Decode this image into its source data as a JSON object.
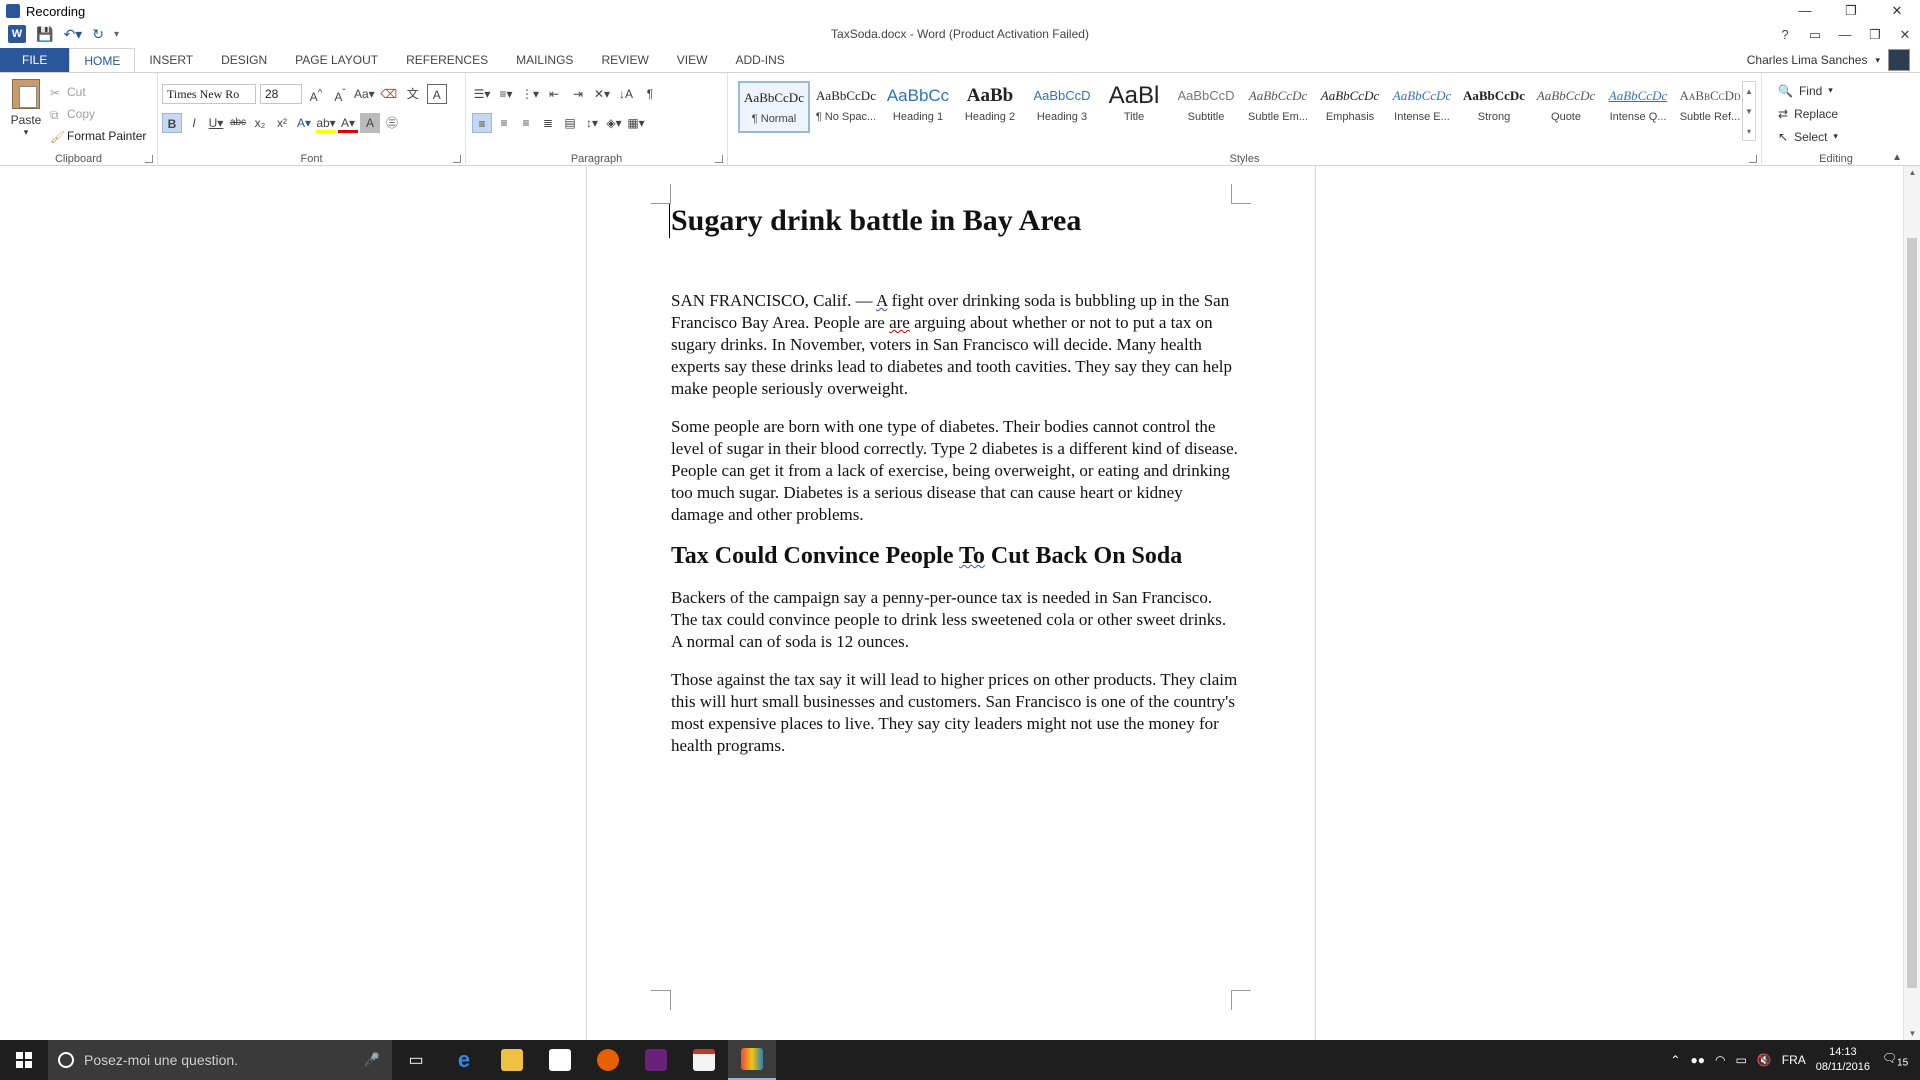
{
  "recording": {
    "title": "Recording"
  },
  "window": {
    "title": "TaxSoda.docx - Word (Product Activation Failed)"
  },
  "ribbon_tabs": [
    "FILE",
    "HOME",
    "INSERT",
    "DESIGN",
    "PAGE LAYOUT",
    "REFERENCES",
    "MAILINGS",
    "REVIEW",
    "VIEW",
    "ADD-INS"
  ],
  "user": {
    "name": "Charles Lima Sanches"
  },
  "clipboard": {
    "paste": "Paste",
    "cut": "Cut",
    "copy": "Copy",
    "format_painter": "Format Painter",
    "label": "Clipboard"
  },
  "font": {
    "name": "Times New Ro",
    "size": "28",
    "label": "Font"
  },
  "paragraph": {
    "label": "Paragraph"
  },
  "styles": {
    "label": "Styles",
    "items": [
      {
        "sample": "AaBbCcDc",
        "name": "¶ Normal"
      },
      {
        "sample": "AaBbCcDc",
        "name": "¶ No Spac..."
      },
      {
        "sample": "AaBbCc",
        "name": "Heading 1"
      },
      {
        "sample": "AaBb",
        "name": "Heading 2"
      },
      {
        "sample": "AaBbCcD",
        "name": "Heading 3"
      },
      {
        "sample": "AaBl",
        "name": "Title"
      },
      {
        "sample": "AaBbCcD",
        "name": "Subtitle"
      },
      {
        "sample": "AaBbCcDc",
        "name": "Subtle Em..."
      },
      {
        "sample": "AaBbCcDc",
        "name": "Emphasis"
      },
      {
        "sample": "AaBbCcDc",
        "name": "Intense E..."
      },
      {
        "sample": "AaBbCcDc",
        "name": "Strong"
      },
      {
        "sample": "AaBbCcDc",
        "name": "Quote"
      },
      {
        "sample": "AaBbCcDc",
        "name": "Intense Q..."
      },
      {
        "sample": "AaBbCcDd",
        "name": "Subtle Ref..."
      }
    ]
  },
  "editing": {
    "find": "Find",
    "replace": "Replace",
    "select": "Select",
    "label": "Editing"
  },
  "document": {
    "title": "Sugary drink battle in Bay Area",
    "p1_a": "SAN FRANCISCO, Calif. — ",
    "p1_b": "A",
    "p1_c": " fight over drinking soda is bubbling up in the San Francisco Bay Area. People are ",
    "p1_d": "are",
    "p1_e": " arguing about whether or not to put a tax on sugary drinks. In November, voters in San Francisco will decide. Many health experts say these drinks lead to diabetes and tooth cavities. They say they can help make people seriously overweight.",
    "p2": "Some people are born with one type of diabetes. Their bodies cannot control the level of sugar in their blood correctly. Type 2 diabetes is a different kind of disease. People can get it from a lack of exercise, being overweight, or eating and drinking too much sugar. Diabetes is a serious disease that can cause heart or kidney damage and other problems.",
    "h2_a": "Tax Could Convince People ",
    "h2_b": "To",
    "h2_c": " Cut Back On Soda",
    "p3": "Backers of the campaign say a penny-per-ounce tax is needed in San Francisco. The tax could convince people to drink less sweetened cola or other sweet drinks. A normal can of soda is 12 ounces.",
    "p4": "Those against the tax say it will lead to higher prices on other products. They claim this will hurt small businesses and customers. San Francisco is one of the country's most expensive places to live. They say city leaders might not use the money for health programs."
  },
  "taskbar": {
    "search_placeholder": "Posez-moi une question.",
    "lang": "FRA",
    "time": "14:13",
    "date": "08/11/2016",
    "notifications": "15"
  },
  "colors": {
    "accent": "#2b579a",
    "taskbar": "#1e1e1e"
  }
}
